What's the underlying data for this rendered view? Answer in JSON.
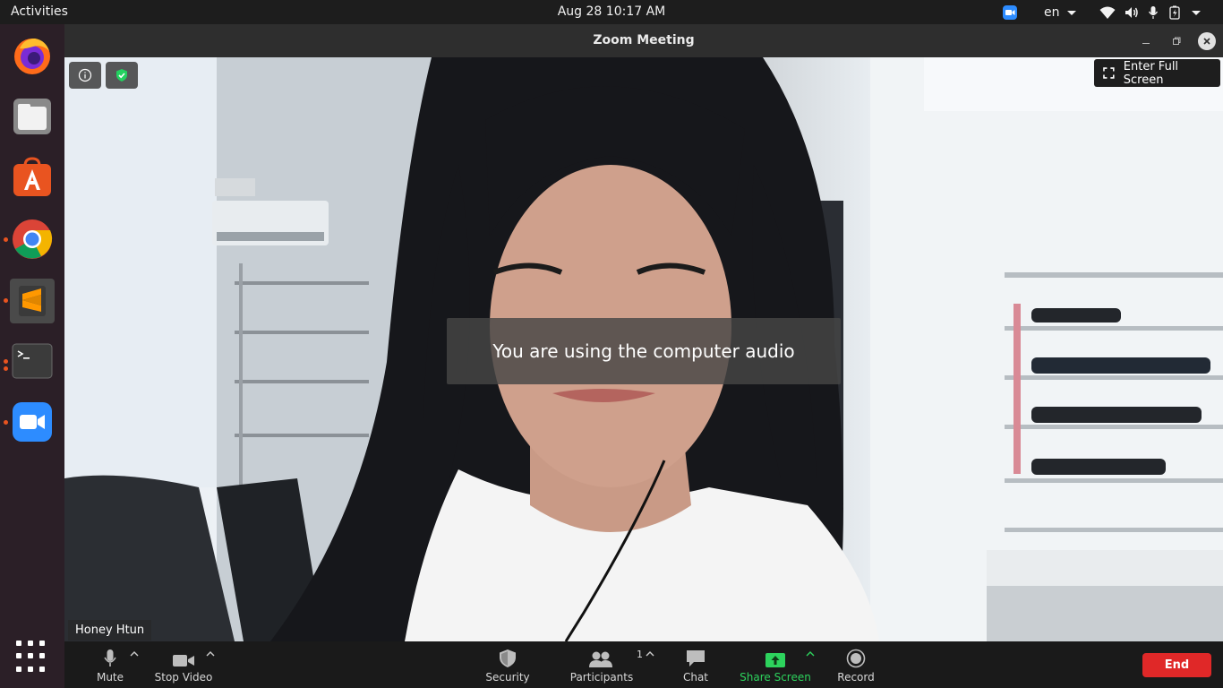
{
  "topbar": {
    "activities": "Activities",
    "datetime": "Aug 28  10:17 AM",
    "language": "en"
  },
  "dock": {
    "apps": [
      "firefox-icon",
      "files-icon",
      "software-center-icon",
      "chrome-icon",
      "sublime-text-icon",
      "terminal-icon",
      "zoom-icon"
    ]
  },
  "window": {
    "title": "Zoom Meeting"
  },
  "video": {
    "fullscreen_label": "Enter Full Screen",
    "toast": "You are using the computer audio",
    "participant_name": "Honey Htun"
  },
  "toolbar": {
    "mute": "Mute",
    "stop_video": "Stop Video",
    "security": "Security",
    "participants": "Participants",
    "participants_count": "1",
    "chat": "Chat",
    "share_screen": "Share Screen",
    "record": "Record",
    "end": "End"
  },
  "colors": {
    "share_green": "#2dd35d",
    "end_red": "#e02828",
    "dock_bg": "#2b1f27",
    "running_dot": "#e95420"
  }
}
